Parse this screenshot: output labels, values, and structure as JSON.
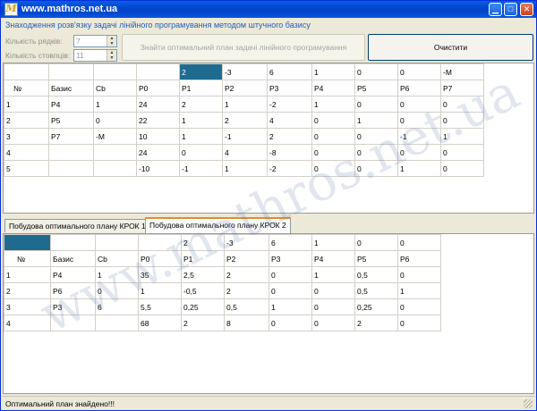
{
  "window": {
    "title": "www.mathros.net.ua"
  },
  "subtitle": "Знаходження розв'язку задачі лінійного програмування методом штучного базису",
  "controls": {
    "rows_label": "Кількість рядків:",
    "rows_value": "7",
    "cols_label": "Кількість стовпців:",
    "cols_value": "11",
    "find_button": "Знайти оптимальний план задачі лінійного програмування",
    "clear_button": "Очистити"
  },
  "top_table": {
    "coef_row": [
      "",
      "",
      "",
      "",
      "2",
      "-3",
      "6",
      "1",
      "0",
      "0",
      "-M"
    ],
    "header": [
      "№",
      "Базис",
      "Cb",
      "P0",
      "P1",
      "P2",
      "P3",
      "P4",
      "P5",
      "P6",
      "P7"
    ],
    "rows": [
      [
        "1",
        "P4",
        "1",
        "24",
        "2",
        "1",
        "-2",
        "1",
        "0",
        "0",
        "0"
      ],
      [
        "2",
        "P5",
        "0",
        "22",
        "1",
        "2",
        "4",
        "0",
        "1",
        "0",
        "0"
      ],
      [
        "3",
        "P7",
        "-M",
        "10",
        "1",
        "-1",
        "2",
        "0",
        "0",
        "-1",
        "1"
      ],
      [
        "4",
        "",
        "",
        "24",
        "0",
        "4",
        "-8",
        "0",
        "0",
        "0",
        "0"
      ],
      [
        "5",
        "",
        "",
        "-10",
        "-1",
        "1",
        "-2",
        "0",
        "0",
        "1",
        "0"
      ]
    ]
  },
  "tabs": [
    {
      "label": "Побудова оптимального плану КРОК 1"
    },
    {
      "label": "Побудова оптимального плану КРОК 2"
    }
  ],
  "bottom_table": {
    "coef_row": [
      "",
      "",
      "",
      "",
      "2",
      "-3",
      "6",
      "1",
      "0",
      "0"
    ],
    "header": [
      "№",
      "Базис",
      "Cb",
      "P0",
      "P1",
      "P2",
      "P3",
      "P4",
      "P5",
      "P6"
    ],
    "rows": [
      [
        "1",
        "P4",
        "1",
        "35",
        "2,5",
        "2",
        "0",
        "1",
        "0,5",
        "0"
      ],
      [
        "2",
        "P6",
        "0",
        "1",
        "-0,5",
        "2",
        "0",
        "0",
        "0,5",
        "1"
      ],
      [
        "3",
        "P3",
        "6",
        "5,5",
        "0,25",
        "0,5",
        "1",
        "0",
        "0,25",
        "0"
      ],
      [
        "4",
        "",
        "",
        "68",
        "2",
        "8",
        "0",
        "0",
        "2",
        "0"
      ]
    ]
  },
  "status": "Оптимальний план знайдено!!!",
  "watermark": "www.mathros.net.ua",
  "colors": {
    "title_bar": "#0a5fe6",
    "selected_cell": "#1f6b8f",
    "subtitle": "#1f5fbd"
  }
}
